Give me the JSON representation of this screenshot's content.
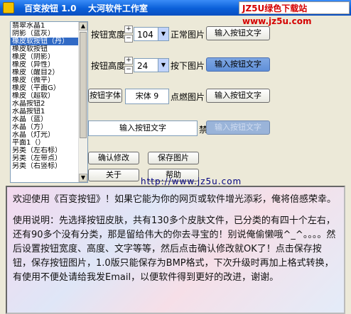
{
  "window": {
    "app_name": "百变按钮 1.0",
    "studio": "大河软件工作室",
    "watermark_prefix": "JZ5U",
    "watermark_text": "绿色下载站 www.jz5u.com"
  },
  "skin_list": {
    "items": [
      "翡翠水晶1",
      "阴影（蓝灰）",
      "橡皮软按钮（丹）",
      "橡皮软按钮",
      "橡皮（阴影）",
      "橡皮（异性）",
      "橡皮（醒目2）",
      "橡皮（微平）",
      "橡皮（平面G）",
      "橡皮（超软）",
      "水晶按钮2",
      "水晶按钮1",
      "水晶（蓝）",
      "水晶（方）",
      "水晶（灯光）",
      "平面1（）",
      "另类（左右标）",
      "另类（左带点）",
      "另类（右竖标）"
    ],
    "selected_index": 2
  },
  "width_row": {
    "label": "按钮宽度",
    "value": "104",
    "pic_label": "正常图片",
    "button": "输入按钮文字"
  },
  "height_row": {
    "label": "按钮高度",
    "value": "24",
    "pic_label": "按下图片",
    "button": "输入按钮文字"
  },
  "font_row": {
    "button": "按钮字体",
    "font_value": "宋体  9",
    "pic_label": "点燃图片",
    "button2": "输入按钮文字"
  },
  "disabled_row": {
    "preview": "输入按钮文字",
    "pic_label": "禁止图片",
    "button": "输入按钮文字"
  },
  "actions": {
    "confirm": "确认修改",
    "save": "保存图片",
    "about": "关于",
    "help": "帮助"
  },
  "link": "http://www.jz5u.com",
  "description": {
    "p1": "欢迎使用《百变按钮》！如果它能为你的网页或软件增光添彩，俺将倍感荣幸。",
    "p2": "使用说明：先选择按钮皮肤，共有130多个皮肤文件，已分类的有四十个左右，还有90多个没有分类，那是留给伟大的你去寻宝的！别说俺偷懒哦^_^。。。。然后设置按钮宽度、高度、文字等等，然后点击确认修改就OK了！点击保存按钮，保存按钮图片，1.0版只能保存为BMP格式，下次升级时再加上格式转换，有使用不便处请给我发Email，以便软件得到更好的改进，谢谢。"
  }
}
